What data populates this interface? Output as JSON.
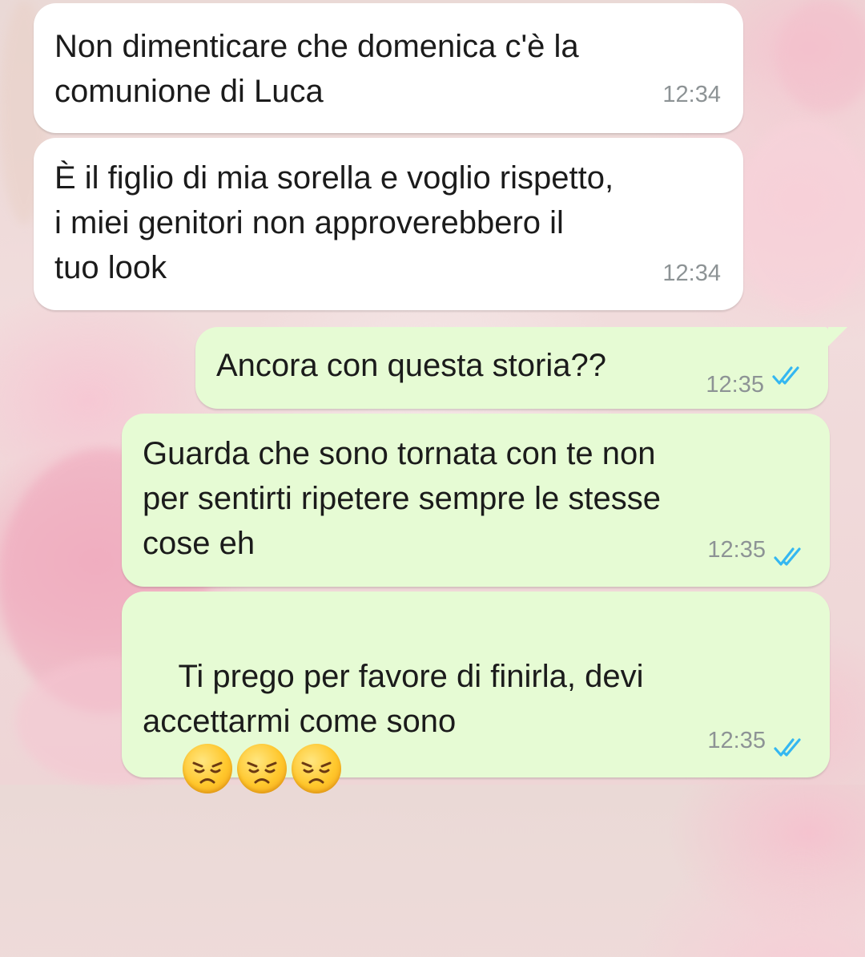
{
  "messages": [
    {
      "id": "m1",
      "direction": "incoming",
      "text": "Non dimenticare che domenica c'è la\ncomunione di Luca",
      "time": "12:34"
    },
    {
      "id": "m2",
      "direction": "incoming",
      "text": "È il figlio di mia sorella e voglio rispetto,\ni miei genitori non approverebbero il\ntuo look",
      "time": "12:34"
    },
    {
      "id": "m3",
      "direction": "outgoing",
      "text": "Ancora con questa storia??",
      "time": "12:35",
      "status": "read"
    },
    {
      "id": "m4",
      "direction": "outgoing",
      "text": "Guarda che sono tornata con te non\nper sentirti ripetere sempre le stesse\ncose eh",
      "time": "12:35",
      "status": "read"
    },
    {
      "id": "m5",
      "direction": "outgoing",
      "text": "Ti prego per favore di finirla, devi\naccettarmi come sono",
      "emojis": [
        "disappointed-face-icon",
        "disappointed-face-icon",
        "disappointed-face-icon"
      ],
      "time": "12:35",
      "status": "read"
    }
  ],
  "colors": {
    "incoming_bubble": "#ffffff",
    "outgoing_bubble": "#e6fbd4",
    "timestamp": "#8d9395",
    "read_ticks": "#34b7f1",
    "text": "#1b1b1b"
  }
}
